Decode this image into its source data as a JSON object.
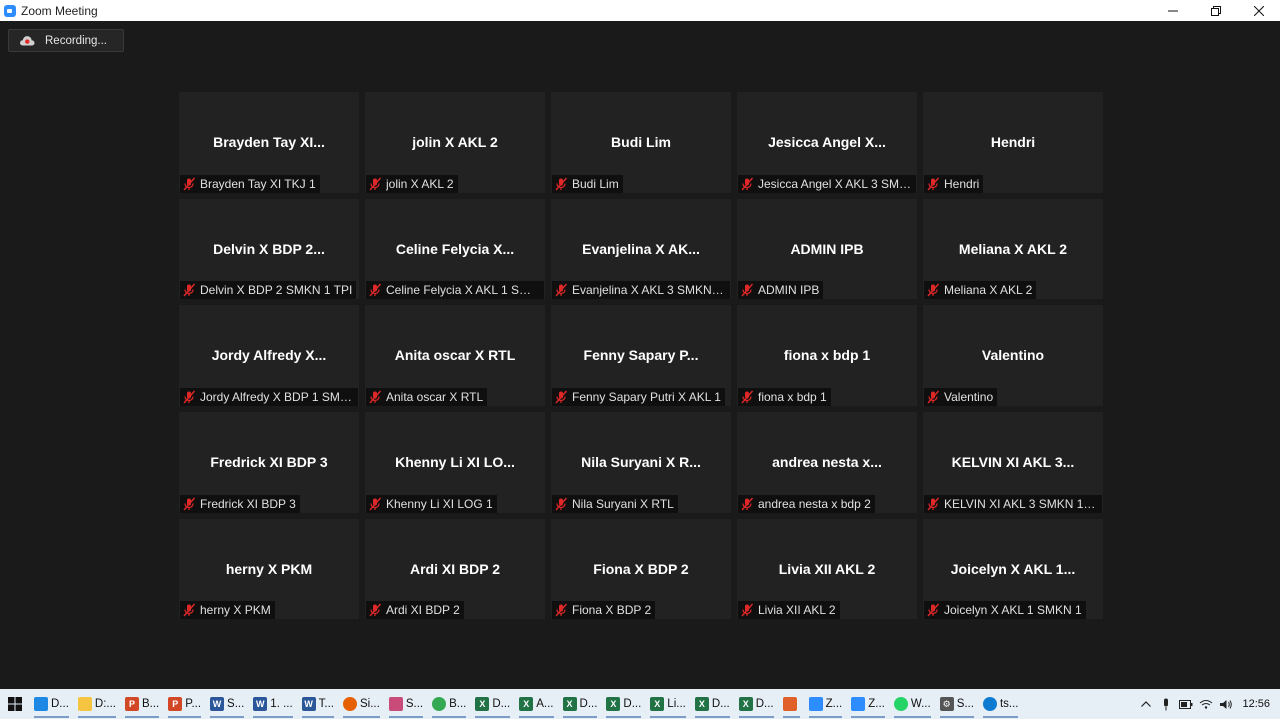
{
  "window": {
    "title": "Zoom Meeting"
  },
  "recording": {
    "label": "Recording..."
  },
  "colors": {
    "background": "#1a1a1a",
    "tile": "#222222",
    "mute": "#e02828",
    "zoom_blue": "#2d8cff"
  },
  "participants": [
    {
      "name": "Brayden Tay XI...",
      "label": "Brayden Tay XI TKJ 1"
    },
    {
      "name": "jolin X AKL 2",
      "label": "jolin X AKL 2"
    },
    {
      "name": "Budi Lim",
      "label": "Budi Lim"
    },
    {
      "name": "Jesicca Angel X...",
      "label": "Jesicca Angel X AKL 3 SMK..."
    },
    {
      "name": "Hendri",
      "label": "Hendri"
    },
    {
      "name": "Delvin X BDP 2...",
      "label": "Delvin X BDP 2 SMKN 1 TPI"
    },
    {
      "name": "Celine Felycia X...",
      "label": "Celine Felycia X AKL 1 SMK..."
    },
    {
      "name": "Evanjelina X AK...",
      "label": "Evanjelina X AKL 3 SMKN 1..."
    },
    {
      "name": "ADMIN IPB",
      "label": "ADMIN IPB"
    },
    {
      "name": "Meliana X AKL 2",
      "label": "Meliana X AKL 2"
    },
    {
      "name": "Jordy Alfredy X...",
      "label": "Jordy Alfredy X BDP 1 SMK..."
    },
    {
      "name": "Anita oscar X RTL",
      "label": "Anita oscar X RTL"
    },
    {
      "name": "Fenny Sapary P...",
      "label": "Fenny Sapary Putri X AKL 1"
    },
    {
      "name": "fiona x bdp 1",
      "label": "fiona x bdp 1"
    },
    {
      "name": "Valentino",
      "label": "Valentino"
    },
    {
      "name": "Fredrick XI BDP 3",
      "label": "Fredrick XI BDP 3"
    },
    {
      "name": "Khenny Li XI LO...",
      "label": "Khenny Li XI LOG 1"
    },
    {
      "name": "Nila Suryani X R...",
      "label": "Nila Suryani X RTL"
    },
    {
      "name": "andrea nesta x...",
      "label": "andrea nesta x bdp 2"
    },
    {
      "name": "KELVIN XI AKL 3...",
      "label": "KELVIN XI AKL 3 SMKN 1 T..."
    },
    {
      "name": "herny X PKM",
      "label": "herny X PKM"
    },
    {
      "name": "Ardi XI BDP 2",
      "label": "Ardi XI BDP 2"
    },
    {
      "name": "Fiona X BDP 2",
      "label": "Fiona X BDP 2"
    },
    {
      "name": "Livia XII AKL 2",
      "label": "Livia XII AKL 2"
    },
    {
      "name": "Joicelyn X AKL 1...",
      "label": "Joicelyn X AKL 1 SMKN 1"
    }
  ],
  "taskbar": {
    "items": [
      {
        "label": "D...",
        "icon": "desktop-icon",
        "color": "#1e88e5",
        "glyph": ""
      },
      {
        "label": "D:...",
        "icon": "folder-icon",
        "color": "#f5c542",
        "glyph": ""
      },
      {
        "label": "B...",
        "icon": "powerpoint-icon",
        "color": "#d24726",
        "glyph": "P"
      },
      {
        "label": "P...",
        "icon": "powerpoint-icon",
        "color": "#d24726",
        "glyph": "P"
      },
      {
        "label": "S...",
        "icon": "word-icon",
        "color": "#2b579a",
        "glyph": "W"
      },
      {
        "label": "1. ...",
        "icon": "word-icon",
        "color": "#2b579a",
        "glyph": "W"
      },
      {
        "label": "T...",
        "icon": "word-icon",
        "color": "#2b579a",
        "glyph": "W"
      },
      {
        "label": "Si...",
        "icon": "firefox-icon",
        "color": "#e66000",
        "glyph": ""
      },
      {
        "label": "S...",
        "icon": "snipping-icon",
        "color": "#c94b7a",
        "glyph": ""
      },
      {
        "label": "B...",
        "icon": "chrome-icon",
        "color": "#34a853",
        "glyph": ""
      },
      {
        "label": "D...",
        "icon": "excel-icon",
        "color": "#217346",
        "glyph": "X"
      },
      {
        "label": "A...",
        "icon": "excel-icon",
        "color": "#217346",
        "glyph": "X"
      },
      {
        "label": "D...",
        "icon": "excel-icon",
        "color": "#217346",
        "glyph": "X"
      },
      {
        "label": "D...",
        "icon": "excel-icon",
        "color": "#217346",
        "glyph": "X"
      },
      {
        "label": "Li...",
        "icon": "excel-icon",
        "color": "#217346",
        "glyph": "X"
      },
      {
        "label": "D...",
        "icon": "excel-icon",
        "color": "#217346",
        "glyph": "X"
      },
      {
        "label": "D...",
        "icon": "excel-icon",
        "color": "#217346",
        "glyph": "X"
      },
      {
        "label": "",
        "icon": "app-icon",
        "color": "#e0602a",
        "glyph": ""
      },
      {
        "label": "Z...",
        "icon": "zoom-icon",
        "color": "#2d8cff",
        "glyph": ""
      },
      {
        "label": "Z...",
        "icon": "zoom-icon",
        "color": "#2d8cff",
        "glyph": ""
      },
      {
        "label": "W...",
        "icon": "whatsapp-icon",
        "color": "#25d366",
        "glyph": ""
      },
      {
        "label": "S...",
        "icon": "settings-icon",
        "color": "#555555",
        "glyph": "⚙"
      },
      {
        "label": "ts...",
        "icon": "edge-icon",
        "color": "#0c7bd1",
        "glyph": ""
      }
    ],
    "clock": "12:56"
  }
}
